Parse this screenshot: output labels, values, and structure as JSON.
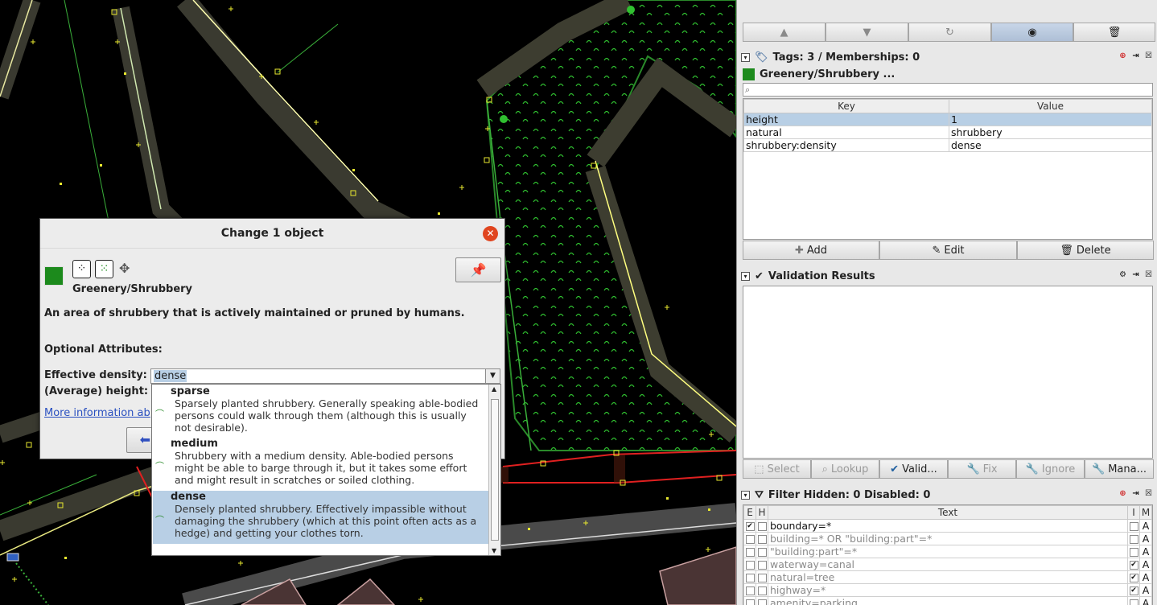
{
  "window": {
    "top_buttons": [
      "up-arrow-icon",
      "down-arrow-icon",
      "redo-icon",
      "eye-icon",
      "trash-icon"
    ]
  },
  "tags_panel": {
    "title": "Tags: 3 / Memberships: 0",
    "preset_name": "Greenery/Shrubbery ...",
    "search_placeholder": "",
    "columns": [
      "Key",
      "Value"
    ],
    "rows": [
      {
        "key": "height",
        "value": "1"
      },
      {
        "key": "natural",
        "value": "shrubbery"
      },
      {
        "key": "shrubbery:density",
        "value": "dense"
      }
    ],
    "buttons": {
      "add": "Add",
      "edit": "Edit",
      "delete": "Delete"
    }
  },
  "validation_panel": {
    "title": "Validation Results",
    "buttons": {
      "select": "Select",
      "lookup": "Lookup",
      "validate": "Valid...",
      "fix": "Fix",
      "ignore": "Ignore",
      "manage": "Mana..."
    }
  },
  "filter_panel": {
    "title": "Filter Hidden: 0 Disabled: 0",
    "columns": {
      "e": "E",
      "h": "H",
      "text": "Text",
      "i": "I",
      "m": "M"
    },
    "rows": [
      {
        "text": "boundary=*",
        "e": true,
        "i": false,
        "m": "A",
        "enabled": true
      },
      {
        "text": "building=* OR \"building:part\"=*",
        "e": false,
        "i": false,
        "m": "A",
        "enabled": false
      },
      {
        "text": "\"building:part\"=*",
        "e": false,
        "i": false,
        "m": "A",
        "enabled": false
      },
      {
        "text": "waterway=canal",
        "e": false,
        "i": true,
        "m": "A",
        "enabled": false
      },
      {
        "text": "natural=tree",
        "e": false,
        "i": true,
        "m": "A",
        "enabled": false
      },
      {
        "text": "highway=*",
        "e": false,
        "i": true,
        "m": "A",
        "enabled": false
      },
      {
        "text": "amenity=parking",
        "e": false,
        "i": false,
        "m": "A",
        "enabled": false
      }
    ]
  },
  "dialog": {
    "title": "Change 1 object",
    "preset_label": "Greenery/Shrubbery",
    "description": "An area of shrubbery that is actively maintained or pruned by humans.",
    "optional_label": "Optional Attributes:",
    "density_label": "Effective density:",
    "density_value": "dense",
    "height_label": "(Average) height:",
    "more_info": "More information ab"
  },
  "dropdown": {
    "options": [
      {
        "title": "sparse",
        "desc": "Sparsely planted shrubbery. Generally speaking able-bodied persons could walk through them (although this is usually not desirable)."
      },
      {
        "title": "medium",
        "desc": "Shrubbery with a medium density. Able-bodied persons might be able to barge through it, but it takes some effort and might result in scratches or soiled clothing."
      },
      {
        "title": "dense",
        "desc": "Densely planted shrubbery. Effectively impassible without damaging the shrubbery (which at this point often acts as a hedge) and getting your clothes torn."
      }
    ],
    "selected": "dense"
  },
  "colors": {
    "accent_selection": "#b8cfe5",
    "close_button": "#e0451f",
    "map_background": "#000000",
    "shrub_green": "#1c6b1c",
    "way_highlight": "#e02020"
  }
}
